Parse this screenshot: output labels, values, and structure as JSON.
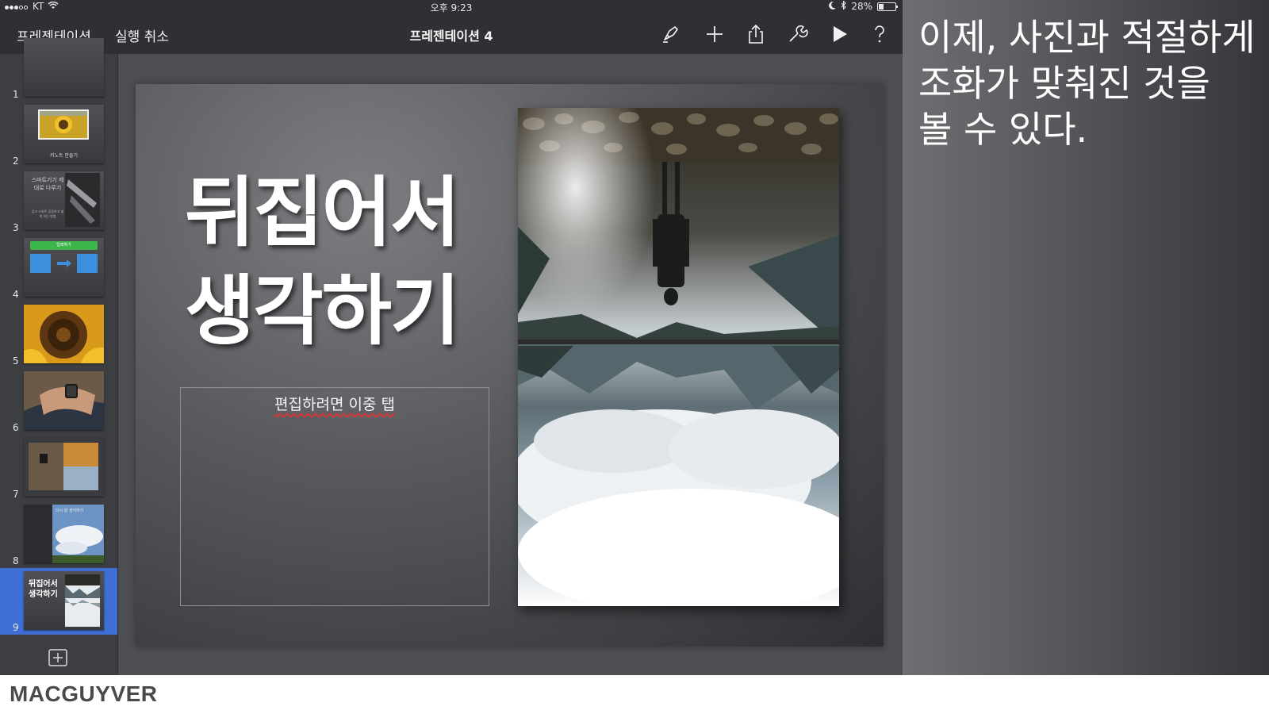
{
  "status_bar": {
    "carrier": "KT",
    "time": "오후 9:23",
    "battery": "28%",
    "battery_level": 0.28
  },
  "toolbar": {
    "presentations_label": "프레젠테이션",
    "undo_label": "실행 취소",
    "document_title": "프레젠테이션 4",
    "icons": [
      "format-brush-icon",
      "plus-icon",
      "share-icon",
      "wrench-icon",
      "play-icon",
      "help-icon"
    ]
  },
  "navigator": {
    "slides": [
      {
        "number": "1"
      },
      {
        "number": "2",
        "caption": "키노트 만들기"
      },
      {
        "number": "3",
        "title": "스마트기기 제대로 다루기",
        "subtitle": "갖고 스마트 꼼꼼하고 쉽게 하는 방법"
      },
      {
        "number": "4",
        "label": "입력하기"
      },
      {
        "number": "5"
      },
      {
        "number": "6"
      },
      {
        "number": "7"
      },
      {
        "number": "8",
        "title": "다시 잘 생각하기"
      },
      {
        "number": "9",
        "title": "뒤집어서 생각하기",
        "selected": true
      }
    ],
    "selected_color": "#3f6ed4"
  },
  "slide": {
    "title_line1": "뒤집어서",
    "title_line2": "생각하기",
    "body_placeholder": "편집하려면 이중 탭"
  },
  "caption": {
    "line1": "이제, 사진과 적절하게",
    "line2": "조화가 맞춰진 것을",
    "line3": "볼 수 있다."
  },
  "footer": {
    "brand": "MACGUYVER"
  }
}
